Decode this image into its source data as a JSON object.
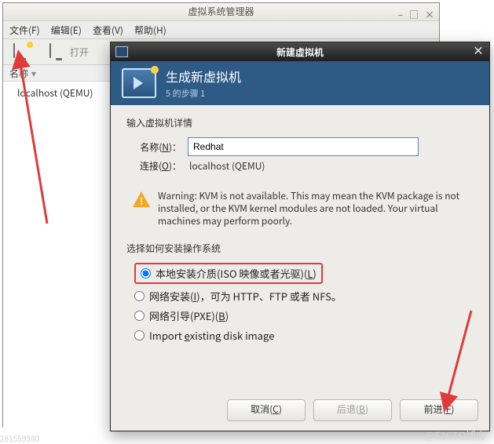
{
  "main_window": {
    "title": "虚拟系统管理器",
    "menu": {
      "file": "文件(F)",
      "edit": "编辑(E)",
      "view": "查看(V)",
      "help": "帮助(H)"
    },
    "toolbar": {
      "open_label": "打开"
    },
    "column_header": "名称",
    "rows": [
      "localhost (QEMU)"
    ]
  },
  "dialog": {
    "title": "新建虚拟机",
    "banner_title": "生成新虚拟机",
    "banner_step": "5 的步骤 1",
    "section_details": "输入虚拟机详情",
    "name_label": "名称(N)：",
    "name_value": "Redhat",
    "conn_label": "连接(O)：",
    "conn_value": "localhost (QEMU)",
    "warning": "Warning: KVM is not available. This may mean the KVM package is not installed, or the KVM kernel modules are not loaded. Your virtual machines may perform poorly.",
    "section_install": "选择如何安装操作系统",
    "options": {
      "local": "本地安装介质(ISO 映像或者光驱)(L)",
      "network": "网络安装(I)，可为 HTTP、FTP 或者 NFS。",
      "pxe": "网络引导(PXE)(B)",
      "import": "Import existing disk image"
    },
    "selected_option": "local",
    "buttons": {
      "cancel": "取消(C)",
      "back": "后退(B)",
      "forward": "前进(F)"
    }
  },
  "watermark": "@51CTO博客",
  "blog_id": "281559980"
}
